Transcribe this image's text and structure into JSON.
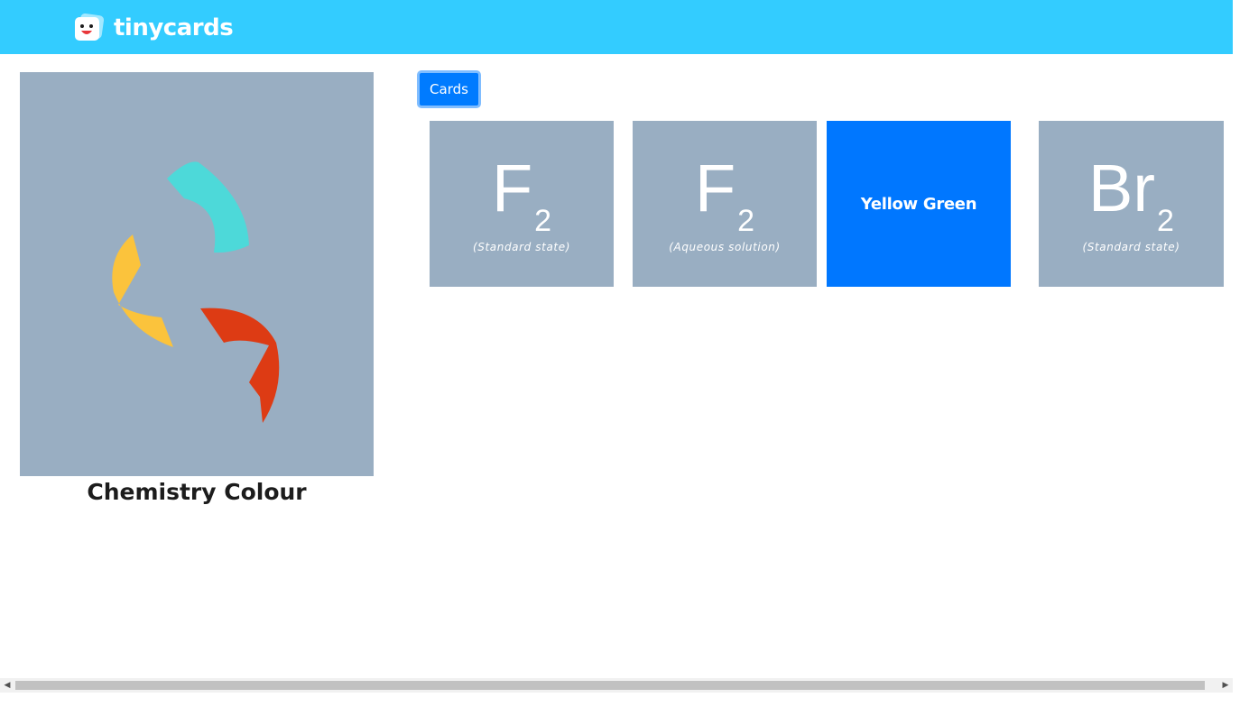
{
  "header": {
    "logo_text": "tinycards",
    "logo_icon": "tinycards-face-icon",
    "background": "#33ccff"
  },
  "deck": {
    "title": "Chemistry Colour",
    "cover_background": "#99aec2",
    "cover_icon": "chemistry-swirl-icon",
    "swirl_colors": [
      "#4dd9d9",
      "#fbc33c",
      "#dd3b14"
    ]
  },
  "tabs": {
    "cards_label": "Cards",
    "active_color": "#007bff"
  },
  "cards": [
    {
      "symbol": "F",
      "subscript": "2",
      "state": "(Standard state)",
      "background": "#99aec2"
    },
    {
      "symbol": "F",
      "subscript": "2",
      "state": "(Aqueous solution)",
      "background": "#99aec2"
    },
    {
      "answer": "Yellow Green",
      "background": "#0077ff"
    },
    {
      "symbol": "Br",
      "subscript": "2",
      "state": "(Standard state)",
      "background": "#99aec2"
    }
  ],
  "scrollbar": {
    "left_arrow": "◀",
    "right_arrow": "▶"
  }
}
